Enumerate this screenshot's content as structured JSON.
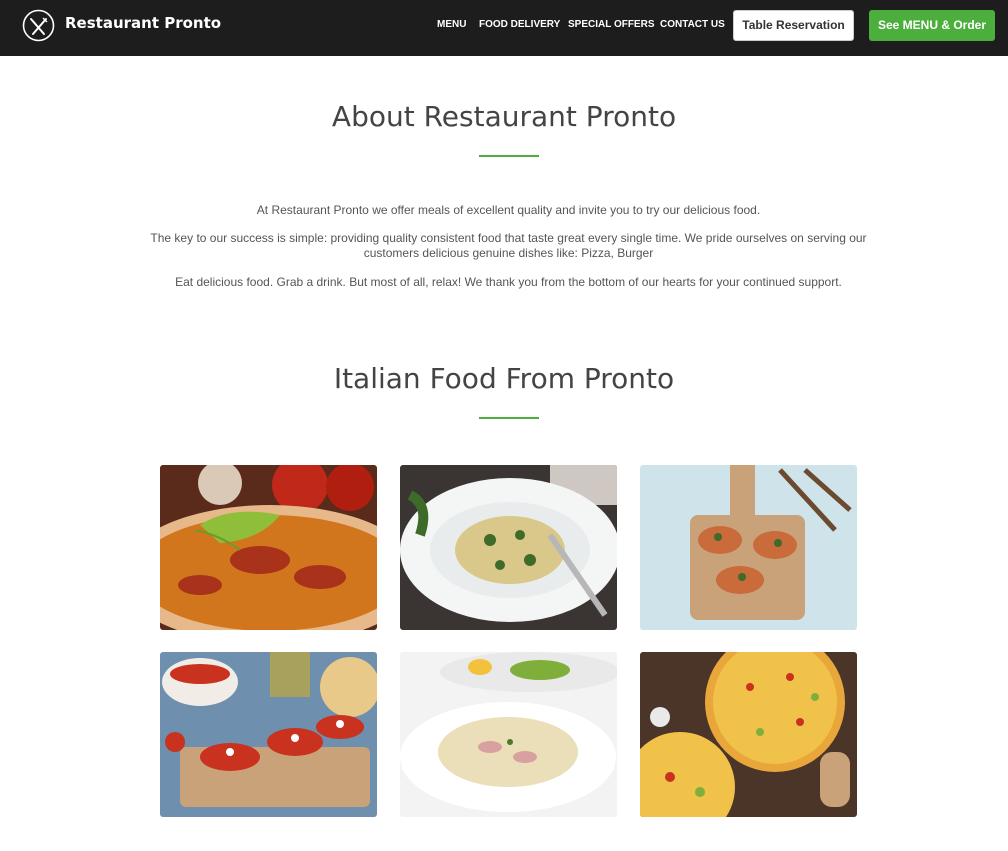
{
  "header": {
    "brand": "Restaurant Pronto",
    "logo_icon": "fork-knife-icon",
    "nav": [
      "MENU",
      "FOOD DELIVERY",
      "SPECIAL OFFERS",
      "CONTACT US"
    ],
    "reservation_button": "Table Reservation",
    "order_button": "See MENU & Order"
  },
  "about": {
    "title": "About Restaurant Pronto",
    "paragraphs": [
      "At Restaurant Pronto we offer meals of excellent quality and invite you to try our delicious food.",
      "The key to our success is simple: providing quality consistent food that taste great every single time. We pride ourselves on serving our customers delicious genuine dishes like: Pizza, Burger",
      "Eat delicious food. Grab a drink. But most of all, relax! We thank you from the bottom of our hearts for your continued support."
    ]
  },
  "gallery": {
    "title": "Italian Food From Pronto",
    "images": [
      {
        "name": "pizza-image"
      },
      {
        "name": "pasta-image"
      },
      {
        "name": "bruschetta-board-image"
      },
      {
        "name": "bruschetta-tomato-image"
      },
      {
        "name": "carbonara-image"
      },
      {
        "name": "pizzas-table-image"
      }
    ]
  },
  "colors": {
    "header_bg": "#1d1d1d",
    "accent_green": "#4caf3d",
    "text_gray": "#555555"
  }
}
